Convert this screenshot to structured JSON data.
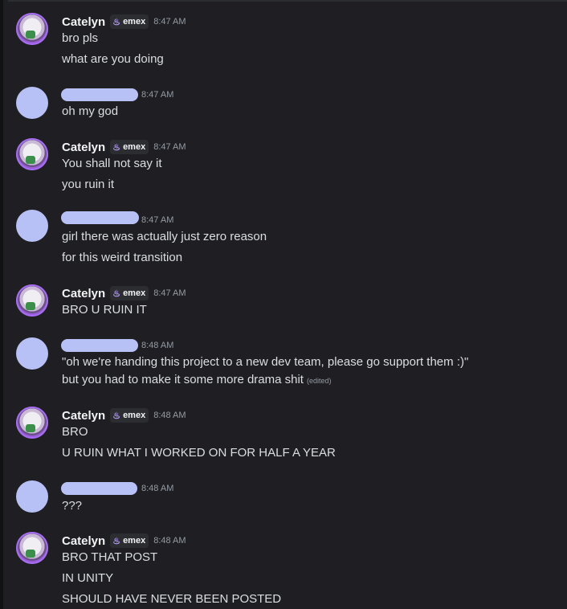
{
  "tag": {
    "label": "emex",
    "icon": "dragon-fire-icon"
  },
  "messages": [
    {
      "author": "Catelyn",
      "time": "8:47 AM",
      "lines": [
        "bro pls",
        "what are you doing"
      ]
    },
    {
      "author": "",
      "time": "8:47 AM",
      "lines": [
        "oh my god"
      ]
    },
    {
      "author": "Catelyn",
      "time": "8:47 AM",
      "lines": [
        "You shall not say it",
        "you ruin it"
      ]
    },
    {
      "author": "",
      "time": "8:47 AM",
      "lines": [
        "girl there was actually just zero reason",
        "for this weird transition"
      ]
    },
    {
      "author": "Catelyn",
      "time": "8:47 AM",
      "lines": [
        "BRO U RUIN IT"
      ]
    },
    {
      "author": "",
      "time": "8:48 AM",
      "lines": [
        "\"oh we're handing this project to a new dev team, please go support them :)\"",
        "but you had to make it some more drama shit"
      ],
      "edited_label": "(edited)"
    },
    {
      "author": "Catelyn",
      "time": "8:48 AM",
      "lines": [
        "BRO",
        "U RUIN WHAT I WORKED ON FOR HALF A YEAR"
      ]
    },
    {
      "author": "",
      "time": "8:48 AM",
      "lines": [
        "???"
      ]
    },
    {
      "author": "Catelyn",
      "time": "8:48 AM",
      "lines": [
        "BRO THAT POST",
        "IN UNITY",
        "SHOULD HAVE NEVER BEEN POSTED"
      ]
    }
  ]
}
